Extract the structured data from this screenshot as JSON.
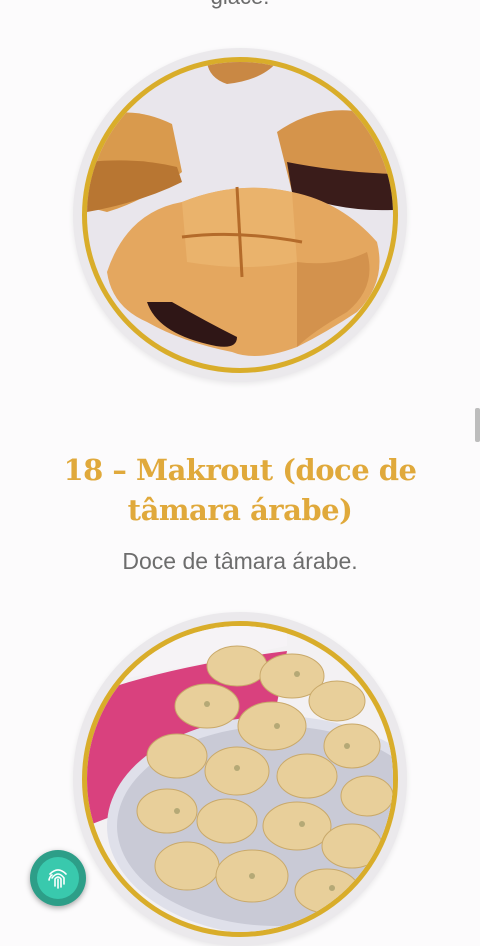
{
  "previous_item": {
    "caption": "glacê."
  },
  "item": {
    "title": "18 – Makrout (doce de tâmara árabe)",
    "description": "Doce de tâmara árabe."
  },
  "colors": {
    "accent": "#e0a93b",
    "ring": "#d9ad2a",
    "fab": "#2d9e88"
  },
  "fab": {
    "icon": "fingerprint-icon"
  }
}
